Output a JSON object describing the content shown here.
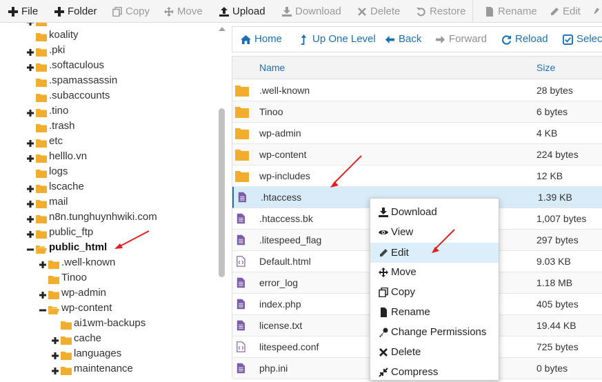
{
  "toolbar": {
    "file": "File",
    "folder": "Folder",
    "copy": "Copy",
    "move": "Move",
    "upload": "Upload",
    "download": "Download",
    "delete": "Delete",
    "restore": "Restore",
    "rename": "Rename",
    "edit": "Edit"
  },
  "tree": {
    "items": [
      {
        "label": "koality",
        "prefix": "."
      },
      {
        "label": ".pki"
      },
      {
        "label": ".softaculous"
      },
      {
        "label": ".spamassassin"
      },
      {
        "label": ".subaccounts"
      },
      {
        "label": ".tino"
      },
      {
        "label": ".trash"
      },
      {
        "label": "etc"
      },
      {
        "label": "helllo.vn"
      },
      {
        "label": "logs"
      },
      {
        "label": "lscache"
      },
      {
        "label": "mail"
      },
      {
        "label": "n8n.tunghuynhwiki.com"
      },
      {
        "label": "public_ftp"
      },
      {
        "label": "public_html"
      },
      {
        "label": ".well-known"
      },
      {
        "label": "Tinoo"
      },
      {
        "label": "wp-admin"
      },
      {
        "label": "wp-content"
      },
      {
        "label": "ai1wm-backups"
      },
      {
        "label": "cache"
      },
      {
        "label": "languages"
      },
      {
        "label": "maintenance"
      }
    ]
  },
  "nav": {
    "home": "Home",
    "up": "Up One Level",
    "back": "Back",
    "forward": "Forward",
    "reload": "Reload",
    "select": "Select"
  },
  "table": {
    "col_name": "Name",
    "col_size": "Size",
    "rows": [
      {
        "name": ".well-known",
        "size": "28 bytes",
        "type": "folder"
      },
      {
        "name": "Tinoo",
        "size": "6 bytes",
        "type": "folder"
      },
      {
        "name": "wp-admin",
        "size": "4 KB",
        "type": "folder"
      },
      {
        "name": "wp-content",
        "size": "224 bytes",
        "type": "folder"
      },
      {
        "name": "wp-includes",
        "size": "12 KB",
        "type": "folder"
      },
      {
        "name": ".htaccess",
        "size": "1.39 KB",
        "type": "text"
      },
      {
        "name": ".htaccess.bk",
        "size": "1,007 bytes",
        "type": "text"
      },
      {
        "name": ".litespeed_flag",
        "size": "297 bytes",
        "type": "text"
      },
      {
        "name": "Default.html",
        "size": "9.03 KB",
        "type": "code"
      },
      {
        "name": "error_log",
        "size": "1.18 MB",
        "type": "text"
      },
      {
        "name": "index.php",
        "size": "405 bytes",
        "type": "text"
      },
      {
        "name": "license.txt",
        "size": "19.44 KB",
        "type": "text"
      },
      {
        "name": "litespeed.conf",
        "size": "725 bytes",
        "type": "code"
      },
      {
        "name": "php.ini",
        "size": "0 bytes",
        "type": "text"
      }
    ]
  },
  "context_menu": {
    "items": [
      "Download",
      "View",
      "Edit",
      "Move",
      "Copy",
      "Rename",
      "Change Permissions",
      "Delete",
      "Compress"
    ]
  },
  "colors": {
    "accent": "#1a6fb5",
    "folder": "#f0ad2e",
    "file_icon": "#7a5ea8",
    "annotation_arrow": "#e02020"
  }
}
